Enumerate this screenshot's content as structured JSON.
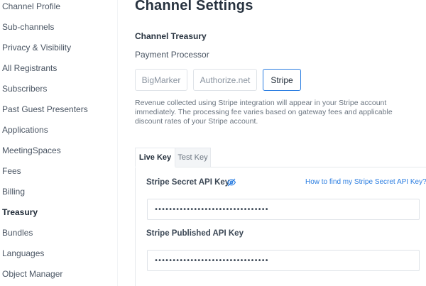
{
  "sidebar": {
    "items": [
      {
        "label": "Channel Profile"
      },
      {
        "label": "Sub-channels"
      },
      {
        "label": "Privacy & Visibility"
      },
      {
        "label": "All Registrants"
      },
      {
        "label": "Subscribers"
      },
      {
        "label": "Past Guest Presenters"
      },
      {
        "label": "Applications"
      },
      {
        "label": "MeetingSpaces"
      },
      {
        "label": "Fees"
      },
      {
        "label": "Billing"
      },
      {
        "label": "Treasury",
        "active": true
      },
      {
        "label": "Bundles"
      },
      {
        "label": "Languages"
      },
      {
        "label": "Object Manager"
      }
    ]
  },
  "main": {
    "title": "Channel Settings",
    "section_title": "Channel Treasury",
    "processor_title": "Payment Processor",
    "processors": [
      {
        "label": "BigMarker"
      },
      {
        "label": "Authorize.net"
      },
      {
        "label": "Stripe",
        "selected": true
      }
    ],
    "description": "Revenue collected using Stripe integration will appear in your Stripe account immediately. The processing fee varies based on gateway fees and applicable discount rates of your Stripe account.",
    "tabs": [
      {
        "label": "Live Key",
        "active": true
      },
      {
        "label": "Test Key"
      }
    ],
    "secret_key": {
      "label": "Stripe Secret API Key",
      "help_link": "How to find my Stripe Secret API Key?",
      "value": "••••••••••••••••••••••••••••••••"
    },
    "published_key": {
      "label": "Stripe Published API Key",
      "value": "••••••••••••••••••••••••••••••••"
    }
  },
  "colors": {
    "accent": "#2a7de1",
    "text_primary": "#27323f",
    "text_muted": "#6b7580",
    "border": "#dfe3e8"
  },
  "icons": {
    "secret_visibility": "eye-slash-icon"
  }
}
